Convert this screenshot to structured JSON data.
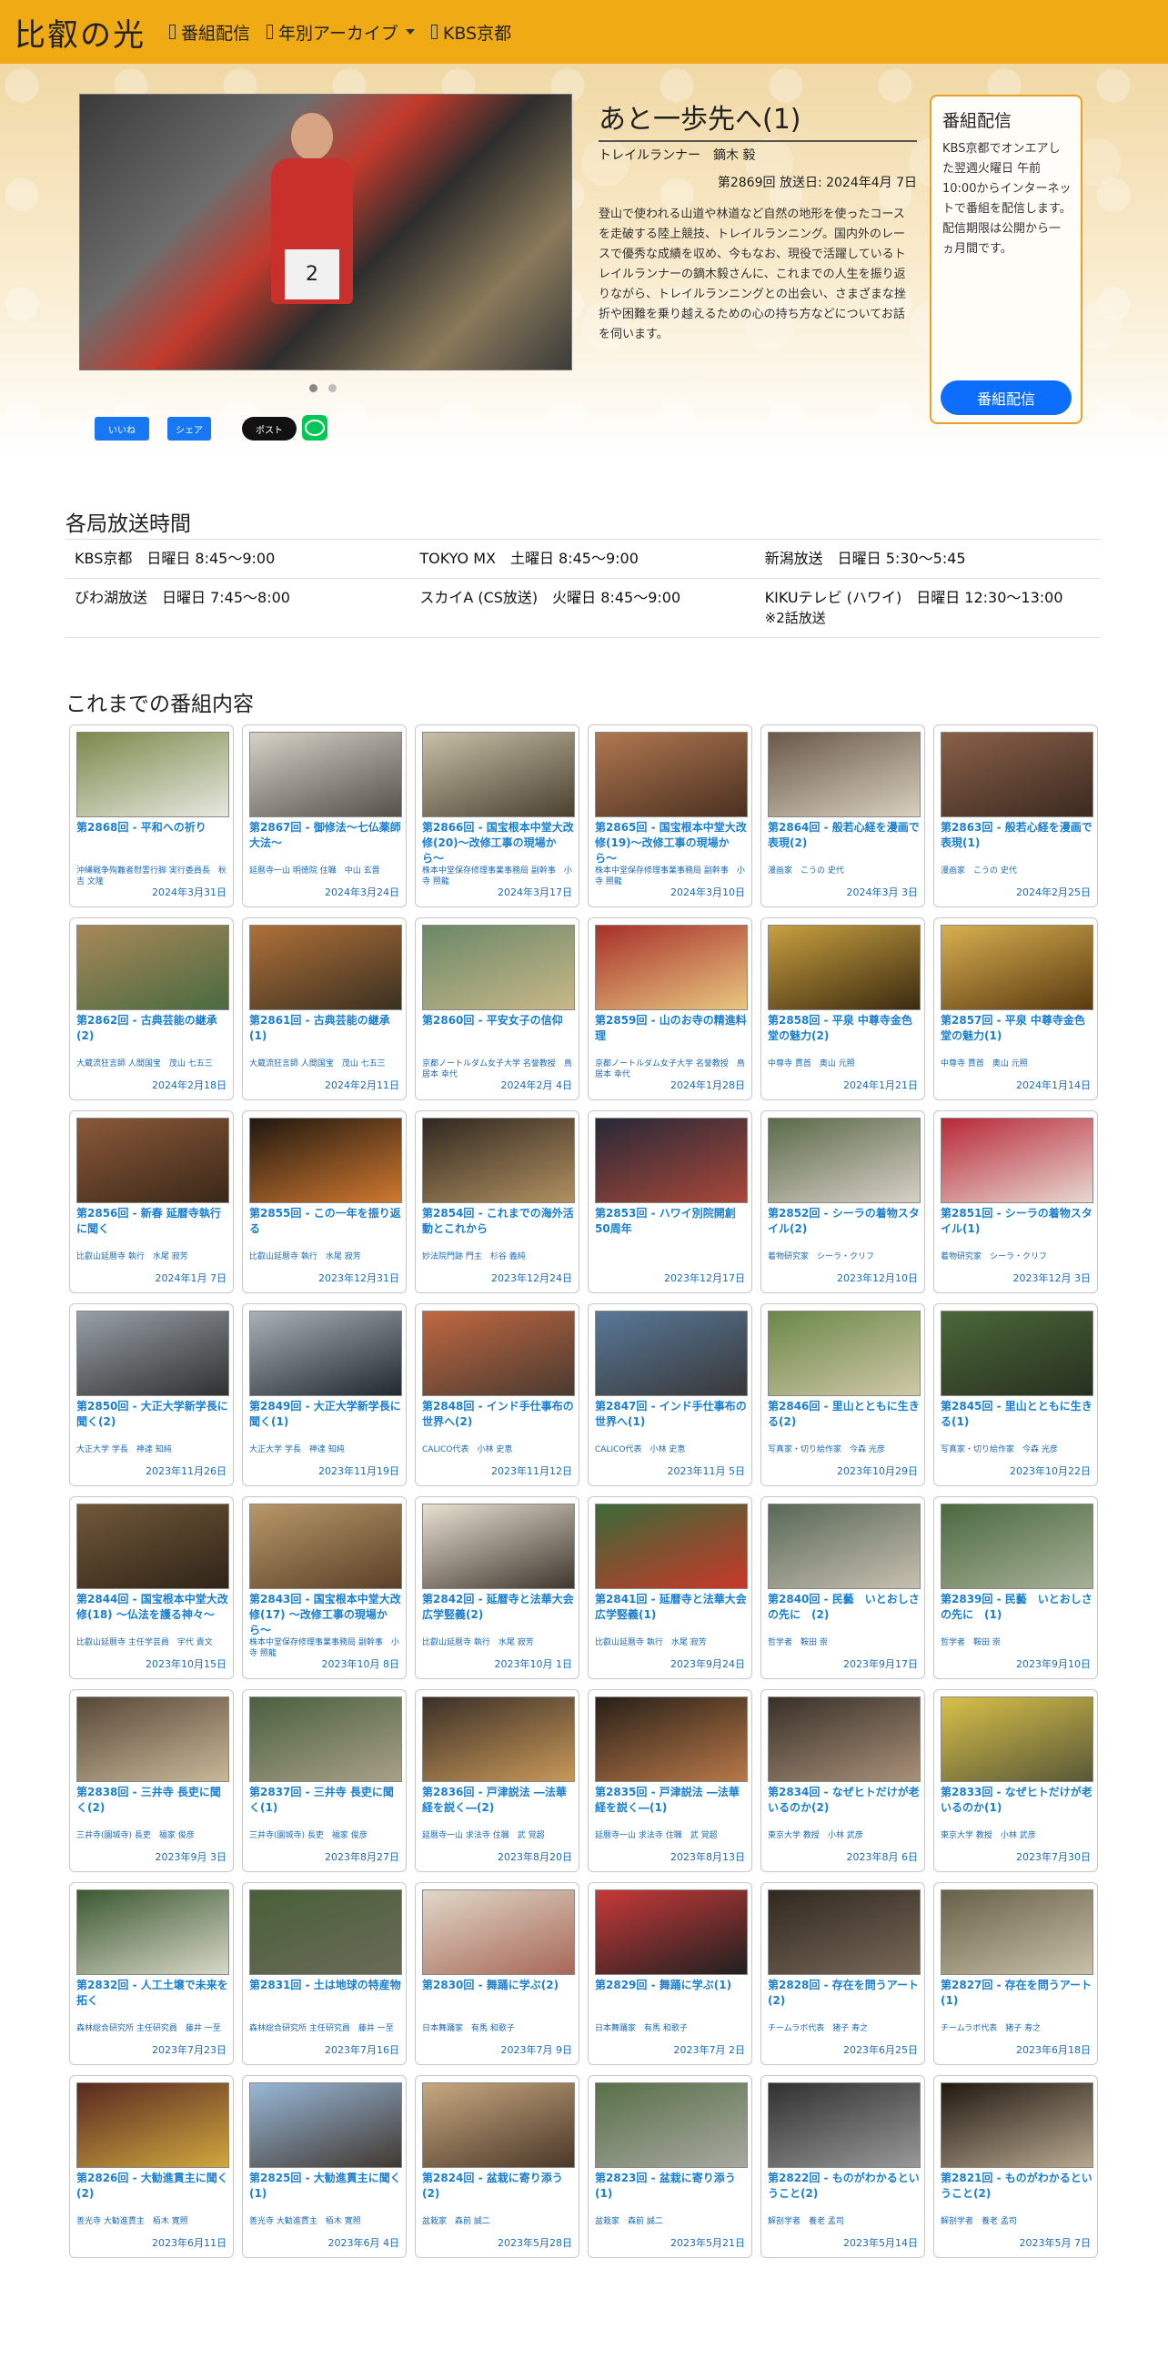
{
  "header": {
    "brand": "比叡の光",
    "nav": [
      {
        "label": "番組配信"
      },
      {
        "label": "年別アーカイブ"
      },
      {
        "label": "KBS京都"
      }
    ]
  },
  "hero": {
    "episode_title": "あと一歩先へ(1)",
    "guest": "トレイルランナー　鏑木 毅",
    "airdate": "第2869回 放送日: 2024年4月 7日",
    "description": "登山で使われる山道や林道など自然の地形を使ったコースを走破する陸上競技、トレイルランニング。国内外のレースで優秀な成績を収め、今もなお、現役で活躍しているトレイルランナーの鏑木毅さんに、これまでの人生を振り返りながら、トレイルランニングとの出会い、さまざまな挫折や困難を乗り越えるための心の持ち方などについてお話を伺います。",
    "photo_bib": "2",
    "share": {
      "fb_like": "いいね",
      "fb_share": "シェア",
      "x_post": "ポスト"
    }
  },
  "side": {
    "title": "番組配信",
    "text": "KBS京都でオンエアした翌週火曜日 午前10:00からインターネットで番組を配信します。配信期限は公開から一ヵ月間です。",
    "button": "番組配信"
  },
  "broadcast": {
    "title": "各局放送時間",
    "rows": [
      [
        "KBS京都　日曜日 8:45〜9:00",
        "TOKYO MX　土曜日 8:45〜9:00",
        "新潟放送　日曜日 5:30〜5:45"
      ],
      [
        "びわ湖放送　日曜日 7:45〜8:00",
        "スカイA (CS放送)　火曜日 8:45〜9:00",
        "KIKUテレビ (ハワイ)　日曜日 12:30〜13:00"
      ]
    ],
    "note": "※2話放送"
  },
  "archive": {
    "title": "これまでの番組内容",
    "episodes": [
      {
        "title": "第2868回 - 平和への祈り",
        "guest": "沖縄戦争殉難者慰霊行脚 実行委員長　秋吉 文隆",
        "date": "2024年3月31日",
        "c1": "#7a8a4a",
        "c2": "#e8e8e0"
      },
      {
        "title": "第2867回 - 御修法〜七仏薬師大法〜",
        "guest": "延暦寺一山 明徳院 住職　中山 玄晋",
        "date": "2024年3月24日",
        "c1": "#d7d2c8",
        "c2": "#555048"
      },
      {
        "title": "第2866回 - 国宝根本中堂大改修(20)〜改修工事の現場から〜",
        "guest": "株本中堂保存修理事業事務局 副幹事　小寺 照龍",
        "date": "2024年3月17日",
        "c1": "#c8c0a8",
        "c2": "#4a4030"
      },
      {
        "title": "第2865回 - 国宝根本中堂大改修(19)〜改修工事の現場から〜",
        "guest": "株本中堂保存修理事業事務局 副幹事　小寺 照龍",
        "date": "2024年3月10日",
        "c1": "#b07850",
        "c2": "#4a3020"
      },
      {
        "title": "第2864回 - 般若心経を漫画で表現(2)",
        "guest": "漫画家　こうの 史代",
        "date": "2024年3月 3日",
        "c1": "#6a5848",
        "c2": "#d8d0c0"
      },
      {
        "title": "第2863回 - 般若心経を漫画で表現(1)",
        "guest": "漫画家　こうの 史代",
        "date": "2024年2月25日",
        "c1": "#8a6048",
        "c2": "#3a2a20"
      },
      {
        "title": "第2862回 - 古典芸能の継承(2)",
        "guest": "大蔵流狂言師 人間国宝　茂山 七五三",
        "date": "2024年2月18日",
        "c1": "#a88858",
        "c2": "#4a6a40"
      },
      {
        "title": "第2861回 - 古典芸能の継承(1)",
        "guest": "大蔵流狂言師 人間国宝　茂山 七五三",
        "date": "2024年2月11日",
        "c1": "#b07038",
        "c2": "#3a3020"
      },
      {
        "title": "第2860回 - 平安女子の信仰",
        "guest": "京都ノートルダム女子大学 名誉教授　鳥居本 幸代",
        "date": "2024年2月 4日",
        "c1": "#6a8868",
        "c2": "#c8b888"
      },
      {
        "title": "第2859回 - 山のお寺の精進料理",
        "guest": "京都ノートルダム女子大学 名誉教授　鳥居本 幸代",
        "date": "2024年1月28日",
        "c1": "#a8302a",
        "c2": "#e8c880"
      },
      {
        "title": "第2858回 - 平泉 中尊寺金色堂の魅力(2)",
        "guest": "中尊寺 貫首　奥山 元照",
        "date": "2024年1月21日",
        "c1": "#c8a040",
        "c2": "#3a2a10"
      },
      {
        "title": "第2857回 - 平泉 中尊寺金色堂の魅力(1)",
        "guest": "中尊寺 貫首　奥山 元照",
        "date": "2024年1月14日",
        "c1": "#d8b050",
        "c2": "#5a3a10"
      },
      {
        "title": "第2856回 - 新春 延暦寺執行に聞く",
        "guest": "比叡山延暦寺 執行　水尾 寂芳",
        "date": "2024年1月 7日",
        "c1": "#8a5838",
        "c2": "#3a2818"
      },
      {
        "title": "第2855回 - この一年を振り返る",
        "guest": "比叡山延暦寺 執行　水尾 寂芳",
        "date": "2023年12月31日",
        "c1": "#201810",
        "c2": "#d07830"
      },
      {
        "title": "第2854回 - これまでの海外活動とこれから",
        "guest": "妙法院門跡 門主　杉谷 義純",
        "date": "2023年12月24日",
        "c1": "#302820",
        "c2": "#b09060"
      },
      {
        "title": "第2853回 - ハワイ別院開創50周年",
        "guest": "",
        "date": "2023年12月17日",
        "c1": "#282838",
        "c2": "#a84838"
      },
      {
        "title": "第2852回 - シーラの着物スタイル(2)",
        "guest": "着物研究家　シーラ・クリフ",
        "date": "2023年12月10日",
        "c1": "#5a6a48",
        "c2": "#d8d0c8"
      },
      {
        "title": "第2851回 - シーラの着物スタイル(1)",
        "guest": "着物研究家　シーラ・クリフ",
        "date": "2023年12月 3日",
        "c1": "#b82838",
        "c2": "#e8d8d0"
      },
      {
        "title": "第2850回 - 大正大学新学長に聞く(2)",
        "guest": "大正大学 学長　神達 知純",
        "date": "2023年11月26日",
        "c1": "#98a0a8",
        "c2": "#303030"
      },
      {
        "title": "第2849回 - 大正大学新学長に聞く(1)",
        "guest": "大正大学 学長　神達 知純",
        "date": "2023年11月19日",
        "c1": "#a8b0b8",
        "c2": "#202830"
      },
      {
        "title": "第2848回 - インド手仕事布の世界へ(2)",
        "guest": "CALICO代表　小林 史恵",
        "date": "2023年11月12日",
        "c1": "#c06840",
        "c2": "#4a3a30"
      },
      {
        "title": "第2847回 - インド手仕事布の世界へ(1)",
        "guest": "CALICO代表　小林 史恵",
        "date": "2023年11月 5日",
        "c1": "#587898",
        "c2": "#383838"
      },
      {
        "title": "第2846回 - 里山とともに生きる(2)",
        "guest": "写真家・切り絵作家　今森 光彦",
        "date": "2023年10月29日",
        "c1": "#6a8848",
        "c2": "#d0c8a8"
      },
      {
        "title": "第2845回 - 里山とともに生きる(1)",
        "guest": "写真家・切り絵作家　今森 光彦",
        "date": "2023年10月22日",
        "c1": "#4a6838",
        "c2": "#283020"
      },
      {
        "title": "第2844回 - 国宝根本中堂大改修(18) 〜仏法を護る神々〜",
        "guest": "比叡山延暦寺 主任学芸員　宇代 貴文",
        "date": "2023年10月15日",
        "c1": "#705838",
        "c2": "#302418"
      },
      {
        "title": "第2843回 - 国宝根本中堂大改修(17) 〜改修工事の現場から〜",
        "guest": "株本中堂保存修理事業事務局 副幹事　小寺 照龍",
        "date": "2023年10月 8日",
        "c1": "#b89868",
        "c2": "#5a4028"
      },
      {
        "title": "第2842回 - 延暦寺と法華大会広学竪義(2)",
        "guest": "比叡山延暦寺 執行　水尾 寂芳",
        "date": "2023年10月 1日",
        "c1": "#e8e0d0",
        "c2": "#403830"
      },
      {
        "title": "第2841回 - 延暦寺と法華大会広学竪義(1)",
        "guest": "比叡山延暦寺 執行　水尾 寂芳",
        "date": "2023年9月24日",
        "c1": "#3a6a38",
        "c2": "#c83828"
      },
      {
        "title": "第2840回 - 民藝　いとおしさの先に　(2)",
        "guest": "哲学者　鞍田 崇",
        "date": "2023年9月17日",
        "c1": "#586858",
        "c2": "#c8c0b0"
      },
      {
        "title": "第2839回 - 民藝　いとおしさの先に　(1)",
        "guest": "哲学者　鞍田 崇",
        "date": "2023年9月10日",
        "c1": "#4a6a40",
        "c2": "#a8b098"
      },
      {
        "title": "第2838回 - 三井寺 長吏に聞く(2)",
        "guest": "三井寺(園城寺) 長吏　福家 俊彦",
        "date": "2023年9月 3日",
        "c1": "#584838",
        "c2": "#c8b898"
      },
      {
        "title": "第2837回 - 三井寺 長吏に聞く(1)",
        "guest": "三井寺(園城寺) 長吏　福家 俊彦",
        "date": "2023年8月27日",
        "c1": "#4a6040",
        "c2": "#a8a088"
      },
      {
        "title": "第2836回 - 戸津説法 ―法華経を説く―(2)",
        "guest": "延暦寺一山 求法寺 住職　武 覚超",
        "date": "2023年8月20日",
        "c1": "#3a3028",
        "c2": "#c89858"
      },
      {
        "title": "第2835回 - 戸津説法 ―法華経を説く―(1)",
        "guest": "延暦寺一山 求法寺 住職　武 覚超",
        "date": "2023年8月13日",
        "c1": "#282018",
        "c2": "#b87848"
      },
      {
        "title": "第2834回 - なぜヒトだけが老いるのか(2)",
        "guest": "東京大学 教授　小林 武彦",
        "date": "2023年8月 6日",
        "c1": "#383028",
        "c2": "#a89078"
      },
      {
        "title": "第2833回 - なぜヒトだけが老いるのか(1)",
        "guest": "東京大学 教授　小林 武彦",
        "date": "2023年7月30日",
        "c1": "#d8c048",
        "c2": "#585838"
      },
      {
        "title": "第2832回 - 人工土壌で未来を拓く",
        "guest": "森林総合研究所 主任研究員　藤井 一至",
        "date": "2023年7月23日",
        "c1": "#3a5830",
        "c2": "#d8d8c8"
      },
      {
        "title": "第2831回 - 土は地球の特産物",
        "guest": "森林総合研究所 主任研究員　藤井 一至",
        "date": "2023年7月16日",
        "c1": "#486038",
        "c2": "#6a6a58"
      },
      {
        "title": "第2830回 - 舞踊に学ぶ(2)",
        "guest": "日本舞踊家　有馬 和歌子",
        "date": "2023年7月 9日",
        "c1": "#e0d8c8",
        "c2": "#a86858"
      },
      {
        "title": "第2829回 - 舞踊に学ぶ(1)",
        "guest": "日本舞踊家　有馬 和歌子",
        "date": "2023年7月 2日",
        "c1": "#c83838",
        "c2": "#202020"
      },
      {
        "title": "第2828回 - 存在を問うアート(2)",
        "guest": "チームラボ代表　猪子 寿之",
        "date": "2023年6月25日",
        "c1": "#302820",
        "c2": "#786858"
      },
      {
        "title": "第2827回 - 存在を問うアート(1)",
        "guest": "チームラボ代表　猪子 寿之",
        "date": "2023年6月18日",
        "c1": "#686048",
        "c2": "#c8c0a8"
      },
      {
        "title": "第2826回 - 大勧進貫主に聞く(2)",
        "guest": "善光寺 大勧進貫主　栢木 寛照",
        "date": "2023年6月11日",
        "c1": "#582820",
        "c2": "#d0a840"
      },
      {
        "title": "第2825回 - 大勧進貫主に聞く(1)",
        "guest": "善光寺 大勧進貫主　栢木 寛照",
        "date": "2023年6月 4日",
        "c1": "#98b8d8",
        "c2": "#403830"
      },
      {
        "title": "第2824回 - 盆栽に寄り添う(2)",
        "guest": "盆栽家　森前 誠二",
        "date": "2023年5月28日",
        "c1": "#c8a880",
        "c2": "#4a3828"
      },
      {
        "title": "第2823回 - 盆栽に寄り添う(1)",
        "guest": "盆栽家　森前 誠二",
        "date": "2023年5月21日",
        "c1": "#587048",
        "c2": "#a8a8a0"
      },
      {
        "title": "第2822回 - ものがわかるということ(2)",
        "guest": "解剖学者　養老 孟司",
        "date": "2023年5月14日",
        "c1": "#303030",
        "c2": "#989898"
      },
      {
        "title": "第2821回 - ものがわかるということ(2)",
        "guest": "解剖学者　養老 孟司",
        "date": "2023年5月 7日",
        "c1": "#201810",
        "c2": "#b8a890"
      }
    ]
  }
}
